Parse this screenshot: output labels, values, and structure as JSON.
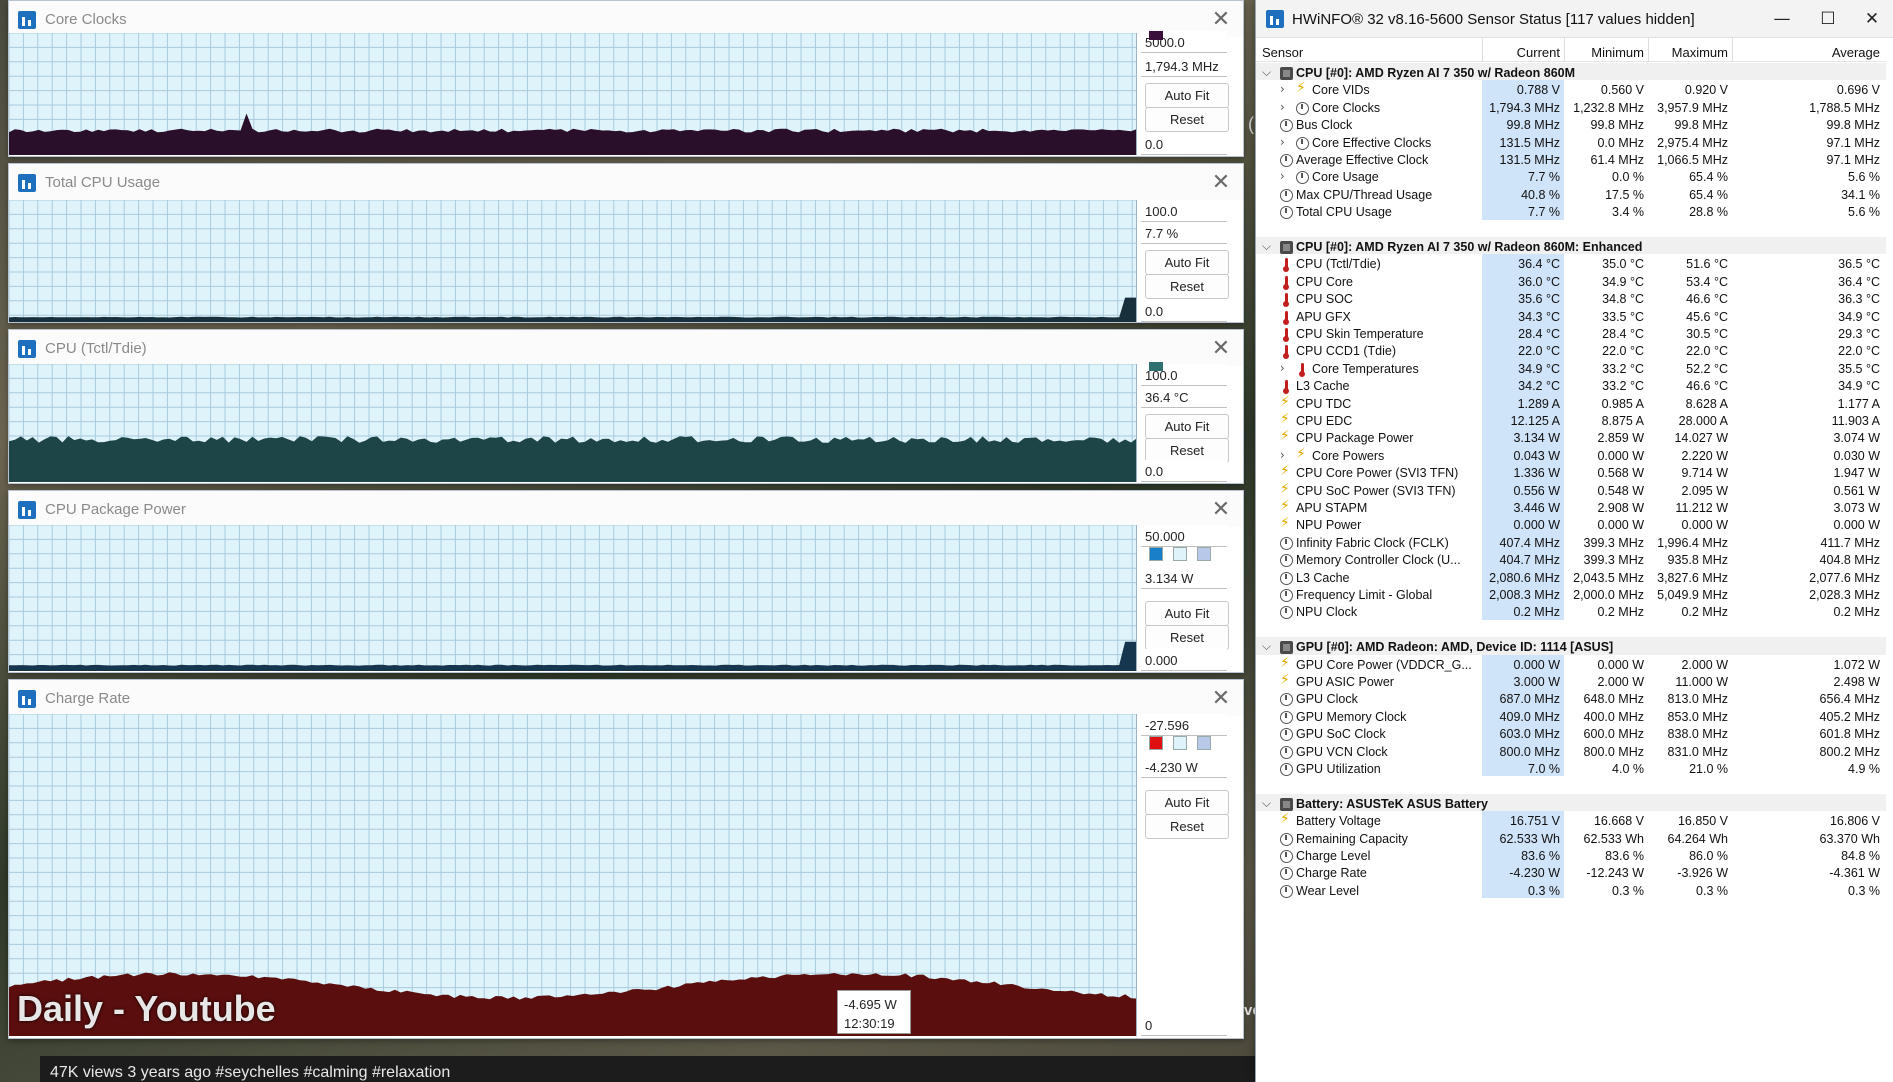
{
  "background": {
    "caption": "47K views  3 years ago  #seychelles #calming #relaxation",
    "side_text": "ve",
    "watermark": "Daily - Youtube"
  },
  "graph_windows": [
    {
      "title": "Core Clocks",
      "max_label": "5000.0",
      "current_label": "1,794.3 MHz",
      "min_label": "0.0",
      "auto_fit": "Auto Fit",
      "reset": "Reset",
      "line_color": "#2a0f2a",
      "level": 0.2,
      "swatch_color": "#3a0f3a"
    },
    {
      "title": "Total CPU Usage",
      "max_label": "100.0",
      "current_label": "7.7 %",
      "min_label": "0.0",
      "auto_fit": "Auto Fit",
      "reset": "Reset",
      "line_color": "#18303c",
      "level": 0.04
    },
    {
      "title": "CPU (Tctl/Tdie)",
      "max_label": "100.0",
      "current_label": "36.4 °C",
      "min_label": "0.0",
      "auto_fit": "Auto Fit",
      "reset": "Reset",
      "line_color": "#1d4446",
      "level": 0.36,
      "swatch_color": "#2f7070"
    },
    {
      "title": "CPU Package Power",
      "max_label": "50.000",
      "current_label": "3.134 W",
      "min_label": "0.000",
      "auto_fit": "Auto Fit",
      "reset": "Reset",
      "line_color": "#15364d",
      "level": 0.04,
      "swatch_colors": [
        "#1a7fc9",
        "#dff3fb",
        "#b7c8e8"
      ]
    },
    {
      "title": "Charge Rate",
      "max_label": "-27.596",
      "current_label": "-4.230 W",
      "min_label": "0",
      "auto_fit": "Auto Fit",
      "reset": "Reset",
      "line_color": "#5a0e0e",
      "level": 0.15,
      "swatch_colors": [
        "#e01010",
        "#dff3fb",
        "#b7c8e8"
      ],
      "tooltip_value": "-4.695 W",
      "tooltip_time": "12:30:19"
    }
  ],
  "hwinfo": {
    "title": "HWiNFO® 32 v8.16-5600 Sensor Status [117 values hidden]",
    "controls": {
      "minimize": "—",
      "maximize": "☐",
      "close": "✕"
    },
    "columns": [
      "Sensor",
      "Current",
      "Minimum",
      "Maximum",
      "Average"
    ],
    "rows": [
      {
        "type": "group",
        "name": "CPU [#0]: AMD Ryzen AI 7 350 w/ Radeon 860M"
      },
      {
        "type": "row",
        "icon": "bolt",
        "expand": true,
        "indent": 1,
        "name": "Core VIDs",
        "cur": "0.788 V",
        "min": "0.560 V",
        "max": "0.920 V",
        "avg": "0.696 V"
      },
      {
        "type": "row",
        "icon": "clock",
        "expand": true,
        "indent": 1,
        "name": "Core Clocks",
        "cur": "1,794.3 MHz",
        "min": "1,232.8 MHz",
        "max": "3,957.9 MHz",
        "avg": "1,788.5 MHz"
      },
      {
        "type": "row",
        "icon": "clock",
        "name": "Bus Clock",
        "cur": "99.8 MHz",
        "min": "99.8 MHz",
        "max": "99.8 MHz",
        "avg": "99.8 MHz"
      },
      {
        "type": "row",
        "icon": "clock",
        "expand": true,
        "indent": 1,
        "name": "Core Effective Clocks",
        "cur": "131.5 MHz",
        "min": "0.0 MHz",
        "max": "2,975.4 MHz",
        "avg": "97.1 MHz"
      },
      {
        "type": "row",
        "icon": "clock",
        "name": "Average Effective Clock",
        "cur": "131.5 MHz",
        "min": "61.4 MHz",
        "max": "1,066.5 MHz",
        "avg": "97.1 MHz"
      },
      {
        "type": "row",
        "icon": "clock",
        "expand": true,
        "indent": 1,
        "name": "Core Usage",
        "cur": "7.7 %",
        "min": "0.0 %",
        "max": "65.4 %",
        "avg": "5.6 %"
      },
      {
        "type": "row",
        "icon": "clock",
        "name": "Max CPU/Thread Usage",
        "cur": "40.8 %",
        "min": "17.5 %",
        "max": "65.4 %",
        "avg": "34.1 %"
      },
      {
        "type": "row",
        "icon": "clock",
        "name": "Total CPU Usage",
        "cur": "7.7 %",
        "min": "3.4 %",
        "max": "28.8 %",
        "avg": "5.6 %"
      },
      {
        "type": "spacer"
      },
      {
        "type": "group",
        "name": "CPU [#0]: AMD Ryzen AI 7 350 w/ Radeon 860M: Enhanced"
      },
      {
        "type": "row",
        "icon": "therm",
        "name": "CPU (Tctl/Tdie)",
        "cur": "36.4 °C",
        "min": "35.0 °C",
        "max": "51.6 °C",
        "avg": "36.5 °C"
      },
      {
        "type": "row",
        "icon": "therm",
        "name": "CPU Core",
        "cur": "36.0 °C",
        "min": "34.9 °C",
        "max": "53.4 °C",
        "avg": "36.4 °C"
      },
      {
        "type": "row",
        "icon": "therm",
        "name": "CPU SOC",
        "cur": "35.6 °C",
        "min": "34.8 °C",
        "max": "46.6 °C",
        "avg": "36.3 °C"
      },
      {
        "type": "row",
        "icon": "therm",
        "name": "APU GFX",
        "cur": "34.3 °C",
        "min": "33.5 °C",
        "max": "45.6 °C",
        "avg": "34.9 °C"
      },
      {
        "type": "row",
        "icon": "therm",
        "name": "CPU Skin Temperature",
        "cur": "28.4 °C",
        "min": "28.4 °C",
        "max": "30.5 °C",
        "avg": "29.3 °C"
      },
      {
        "type": "row",
        "icon": "therm",
        "name": "CPU CCD1 (Tdie)",
        "cur": "22.0 °C",
        "min": "22.0 °C",
        "max": "22.0 °C",
        "avg": "22.0 °C"
      },
      {
        "type": "row",
        "icon": "therm",
        "expand": true,
        "indent": 1,
        "name": "Core Temperatures",
        "cur": "34.9 °C",
        "min": "33.2 °C",
        "max": "52.2 °C",
        "avg": "35.5 °C"
      },
      {
        "type": "row",
        "icon": "therm",
        "name": "L3 Cache",
        "cur": "34.2 °C",
        "min": "33.2 °C",
        "max": "46.6 °C",
        "avg": "34.9 °C"
      },
      {
        "type": "row",
        "icon": "bolt",
        "name": "CPU TDC",
        "cur": "1.289 A",
        "min": "0.985 A",
        "max": "8.628 A",
        "avg": "1.177 A"
      },
      {
        "type": "row",
        "icon": "bolt",
        "name": "CPU EDC",
        "cur": "12.125 A",
        "min": "8.875 A",
        "max": "28.000 A",
        "avg": "11.903 A"
      },
      {
        "type": "row",
        "icon": "bolt",
        "name": "CPU Package Power",
        "cur": "3.134 W",
        "min": "2.859 W",
        "max": "14.027 W",
        "avg": "3.074 W"
      },
      {
        "type": "row",
        "icon": "bolt",
        "expand": true,
        "indent": 1,
        "name": "Core Powers",
        "cur": "0.043 W",
        "min": "0.000 W",
        "max": "2.220 W",
        "avg": "0.030 W"
      },
      {
        "type": "row",
        "icon": "bolt",
        "name": "CPU Core Power (SVI3 TFN)",
        "cur": "1.336 W",
        "min": "0.568 W",
        "max": "9.714 W",
        "avg": "1.947 W"
      },
      {
        "type": "row",
        "icon": "bolt",
        "name": "CPU SoC Power (SVI3 TFN)",
        "cur": "0.556 W",
        "min": "0.548 W",
        "max": "2.095 W",
        "avg": "0.561 W"
      },
      {
        "type": "row",
        "icon": "bolt",
        "name": "APU STAPM",
        "cur": "3.446 W",
        "min": "2.908 W",
        "max": "11.212 W",
        "avg": "3.073 W"
      },
      {
        "type": "row",
        "icon": "bolt",
        "name": "NPU Power",
        "cur": "0.000 W",
        "min": "0.000 W",
        "max": "0.000 W",
        "avg": "0.000 W"
      },
      {
        "type": "row",
        "icon": "clock",
        "name": "Infinity Fabric Clock (FCLK)",
        "cur": "407.4 MHz",
        "min": "399.3 MHz",
        "max": "1,996.4 MHz",
        "avg": "411.7 MHz"
      },
      {
        "type": "row",
        "icon": "clock",
        "name": "Memory Controller Clock (U...",
        "cur": "404.7 MHz",
        "min": "399.3 MHz",
        "max": "935.8 MHz",
        "avg": "404.8 MHz"
      },
      {
        "type": "row",
        "icon": "clock",
        "name": "L3 Cache",
        "cur": "2,080.6 MHz",
        "min": "2,043.5 MHz",
        "max": "3,827.6 MHz",
        "avg": "2,077.6 MHz"
      },
      {
        "type": "row",
        "icon": "clock",
        "name": "Frequency Limit - Global",
        "cur": "2,008.3 MHz",
        "min": "2,000.0 MHz",
        "max": "5,049.9 MHz",
        "avg": "2,028.3 MHz"
      },
      {
        "type": "row",
        "icon": "clock",
        "name": "NPU Clock",
        "cur": "0.2 MHz",
        "min": "0.2 MHz",
        "max": "0.2 MHz",
        "avg": "0.2 MHz"
      },
      {
        "type": "spacer"
      },
      {
        "type": "group",
        "name": "GPU [#0]: AMD Radeon: AMD, Device ID: 1114 [ASUS]"
      },
      {
        "type": "row",
        "icon": "bolt",
        "name": "GPU Core Power (VDDCR_G...",
        "cur": "0.000 W",
        "min": "0.000 W",
        "max": "2.000 W",
        "avg": "1.072 W"
      },
      {
        "type": "row",
        "icon": "bolt",
        "name": "GPU ASIC Power",
        "cur": "3.000 W",
        "min": "2.000 W",
        "max": "11.000 W",
        "avg": "2.498 W"
      },
      {
        "type": "row",
        "icon": "clock",
        "name": "GPU Clock",
        "cur": "687.0 MHz",
        "min": "648.0 MHz",
        "max": "813.0 MHz",
        "avg": "656.4 MHz"
      },
      {
        "type": "row",
        "icon": "clock",
        "name": "GPU Memory Clock",
        "cur": "409.0 MHz",
        "min": "400.0 MHz",
        "max": "853.0 MHz",
        "avg": "405.2 MHz"
      },
      {
        "type": "row",
        "icon": "clock",
        "name": "GPU SoC Clock",
        "cur": "603.0 MHz",
        "min": "600.0 MHz",
        "max": "838.0 MHz",
        "avg": "601.8 MHz"
      },
      {
        "type": "row",
        "icon": "clock",
        "name": "GPU VCN Clock",
        "cur": "800.0 MHz",
        "min": "800.0 MHz",
        "max": "831.0 MHz",
        "avg": "800.2 MHz"
      },
      {
        "type": "row",
        "icon": "clock",
        "name": "GPU Utilization",
        "cur": "7.0 %",
        "min": "4.0 %",
        "max": "21.0 %",
        "avg": "4.9 %"
      },
      {
        "type": "spacer"
      },
      {
        "type": "group",
        "name": "Battery: ASUSTeK ASUS Battery"
      },
      {
        "type": "row",
        "icon": "bolt",
        "name": "Battery Voltage",
        "cur": "16.751 V",
        "min": "16.668 V",
        "max": "16.850 V",
        "avg": "16.806 V"
      },
      {
        "type": "row",
        "icon": "clock",
        "name": "Remaining Capacity",
        "cur": "62.533 Wh",
        "min": "62.533 Wh",
        "max": "64.264 Wh",
        "avg": "63.370 Wh"
      },
      {
        "type": "row",
        "icon": "clock",
        "name": "Charge Level",
        "cur": "83.6 %",
        "min": "83.6 %",
        "max": "86.0 %",
        "avg": "84.8 %"
      },
      {
        "type": "row",
        "icon": "clock",
        "name": "Charge Rate",
        "cur": "-4.230 W",
        "min": "-12.243 W",
        "max": "-3.926 W",
        "avg": "-4.361 W"
      },
      {
        "type": "row",
        "icon": "clock",
        "name": "Wear Level",
        "cur": "0.3 %",
        "min": "0.3 %",
        "max": "0.3 %",
        "avg": "0.3 %"
      }
    ]
  }
}
